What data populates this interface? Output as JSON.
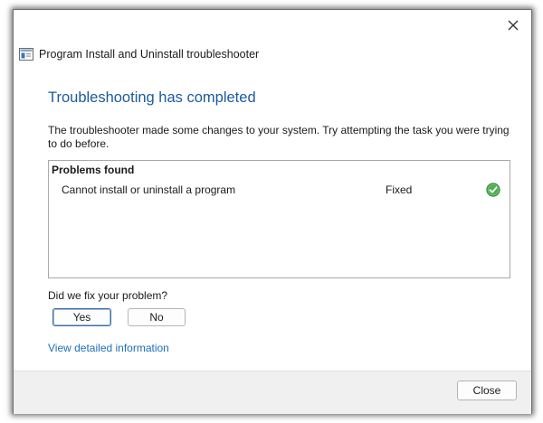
{
  "window": {
    "title": "Program Install and Uninstall troubleshooter"
  },
  "main": {
    "heading": "Troubleshooting has completed",
    "description": "The troubleshooter made some changes to your system. Try attempting the task you were trying to do before.",
    "problems": {
      "header": "Problems found",
      "rows": [
        {
          "name": "Cannot install or uninstall a program",
          "status": "Fixed",
          "status_icon": "check-circle-icon",
          "status_color": "#4caf50"
        }
      ]
    },
    "question": "Did we fix your problem?",
    "yes_label": "Yes",
    "no_label": "No",
    "details_link": "View detailed information"
  },
  "footer": {
    "close_label": "Close"
  },
  "colors": {
    "heading": "#1b5a9b",
    "link": "#1f6fb8",
    "footer_bg": "#f0f0f0"
  }
}
